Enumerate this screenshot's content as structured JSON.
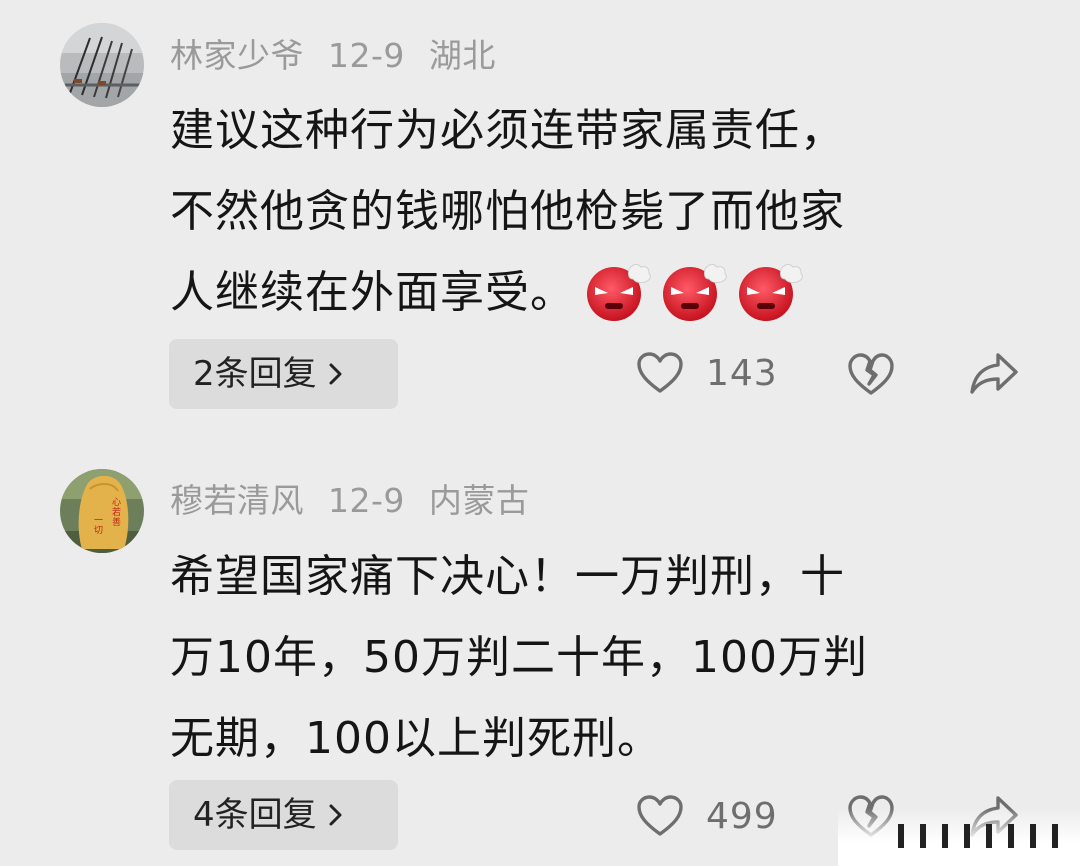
{
  "comments": [
    {
      "username": "林家少爷",
      "date": "12-9",
      "location": "湖北",
      "avatar_icon": "fishing-rods-avatar",
      "text_lines": [
        "建议这种行为必须连带家属责任，",
        "不然他贪的钱哪怕他枪毙了而他家",
        "人继续在外面享受。"
      ],
      "emojis": [
        "angry-face-emoji",
        "angry-face-emoji",
        "angry-face-emoji"
      ],
      "replies_label": "2条回复",
      "likes": "143"
    },
    {
      "username": "穆若清风",
      "date": "12-9",
      "location": "内蒙古",
      "avatar_icon": "stone-calligraphy-avatar",
      "text_lines": [
        "希望国家痛下决心！一万判刑，十",
        "万10年，50万判二十年，100万判",
        "无期，100以上判死刑。"
      ],
      "emojis": [],
      "replies_label": "4条回复",
      "likes": "499"
    }
  ],
  "colors": {
    "background": "#ececec",
    "meta_text": "#9a9a9a",
    "body_text": "#151515",
    "reply_button_bg": "#dcdcdc",
    "icon_gray": "#6e6e6e",
    "emoji_red": "#e8323e"
  }
}
